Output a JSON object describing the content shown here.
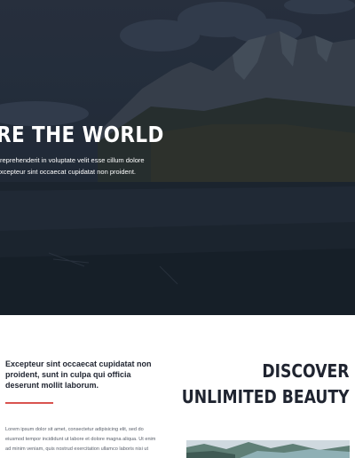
{
  "hero": {
    "title": "RE THE WORLD",
    "text_line1": "reprehenderit in voluptate velit esse cillum dolore",
    "text_line2": "xcepteur sint occaecat cupidatat non proident."
  },
  "intro": {
    "lead": "Excepteur sint occaecat cupidatat non proident, sunt in culpa qui officia deserunt mollit laborum.",
    "body_line1": "Lorem ipsum dolor sit amet, consectetur adipisicing elit, sed do",
    "body_line2": "eiusmod tempor incididunt ut labore et dolore magna aliqua. Ut enim",
    "body_line3": "ad minim veniam, quis nostrud exercitation ullamco laboris nisi ut"
  },
  "discover": {
    "line1": "DISCOVER",
    "line2": "UNLIMITED BEAUTY"
  },
  "colors": {
    "accent": "#d9534f",
    "hero_overlay": "#232d3a",
    "heading": "#1f2430"
  }
}
